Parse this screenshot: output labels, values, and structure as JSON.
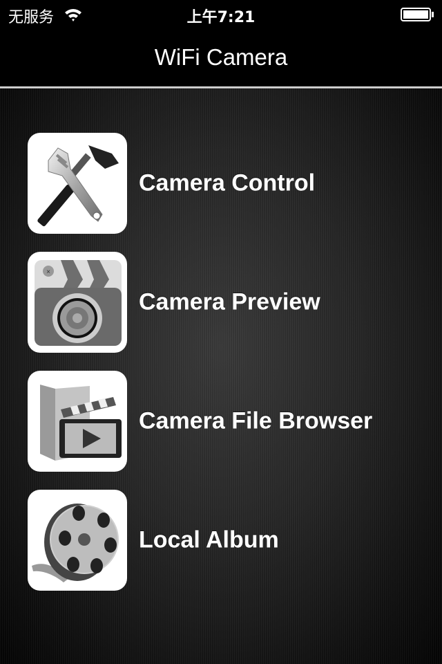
{
  "status_bar": {
    "carrier": "无服务",
    "time": "上午7:21",
    "wifi_icon": "wifi-icon",
    "battery_icon": "battery-icon"
  },
  "nav": {
    "title": "WiFi Camera"
  },
  "menu": {
    "items": [
      {
        "label": "Camera Control",
        "icon": "tools-icon"
      },
      {
        "label": "Camera Preview",
        "icon": "clapper-camera-icon"
      },
      {
        "label": "Camera File Browser",
        "icon": "video-folder-icon"
      },
      {
        "label": "Local Album",
        "icon": "film-reel-icon"
      }
    ]
  }
}
